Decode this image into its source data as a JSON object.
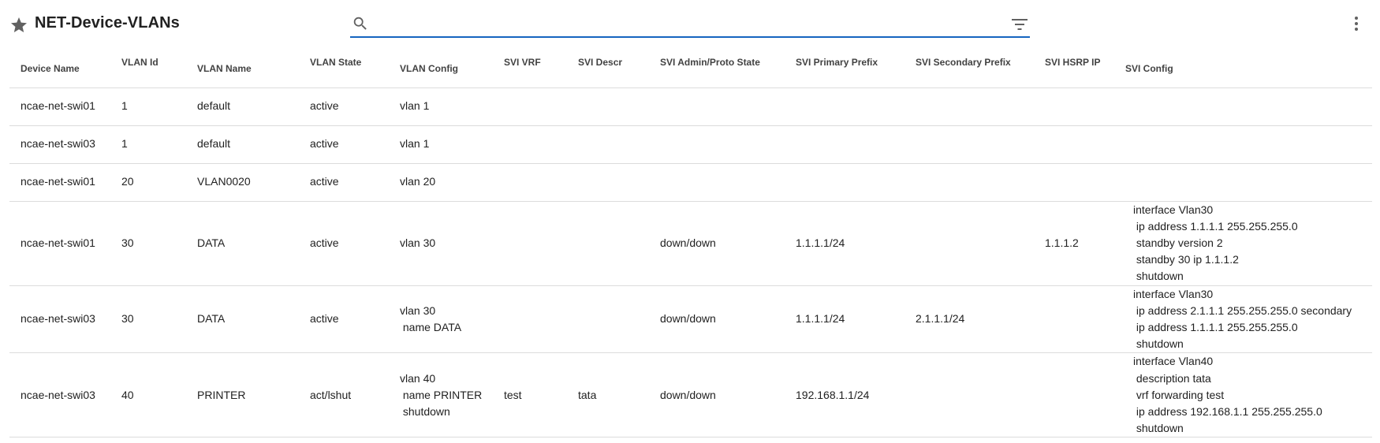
{
  "header": {
    "title": "NET-Device-VLANs",
    "search_value": "",
    "search_placeholder": ""
  },
  "icons": {
    "favorite": "star-icon",
    "search": "search-icon",
    "filter": "filter-icon",
    "more": "more-vert-icon"
  },
  "colors": {
    "accent": "#1565c0",
    "divider": "#dcdcdc",
    "icon": "#616161"
  },
  "table": {
    "columns": [
      "Device Name",
      "VLAN Id",
      "VLAN Name",
      "VLAN State",
      "VLAN Config",
      "SVI VRF",
      "SVI Descr",
      "SVI Admin/Proto State",
      "SVI Primary Prefix",
      "SVI Secondary Prefix",
      "SVI HSRP IP",
      "SVI Config"
    ],
    "rows": [
      [
        "ncae-net-swi01",
        "1",
        "default",
        "active",
        "vlan 1",
        "",
        "",
        "",
        "",
        "",
        "",
        ""
      ],
      [
        "ncae-net-swi03",
        "1",
        "default",
        "active",
        "vlan 1",
        "",
        "",
        "",
        "",
        "",
        "",
        ""
      ],
      [
        "ncae-net-swi01",
        "20",
        "VLAN0020",
        "active",
        "vlan 20",
        "",
        "",
        "",
        "",
        "",
        "",
        ""
      ],
      [
        "ncae-net-swi01",
        "30",
        "DATA",
        "active",
        "vlan 30",
        "",
        "",
        "down/down",
        "1.1.1.1/24",
        "",
        "1.1.1.2",
        "interface Vlan30\n ip address 1.1.1.1 255.255.255.0\n standby version 2\n standby 30 ip 1.1.1.2\n shutdown"
      ],
      [
        "ncae-net-swi03",
        "30",
        "DATA",
        "active",
        "vlan 30\n name DATA",
        "",
        "",
        "down/down",
        "1.1.1.1/24",
        "2.1.1.1/24",
        "",
        "interface Vlan30\n ip address 2.1.1.1 255.255.255.0 secondary\n ip address 1.1.1.1 255.255.255.0\n shutdown"
      ],
      [
        "ncae-net-swi03",
        "40",
        "PRINTER",
        "act/lshut",
        "vlan 40\n name PRINTER\n shutdown",
        "test",
        "tata",
        "down/down",
        "192.168.1.1/24",
        "",
        "",
        "interface Vlan40\n description tata\n vrf forwarding test\n ip address 192.168.1.1 255.255.255.0\n shutdown"
      ]
    ]
  }
}
